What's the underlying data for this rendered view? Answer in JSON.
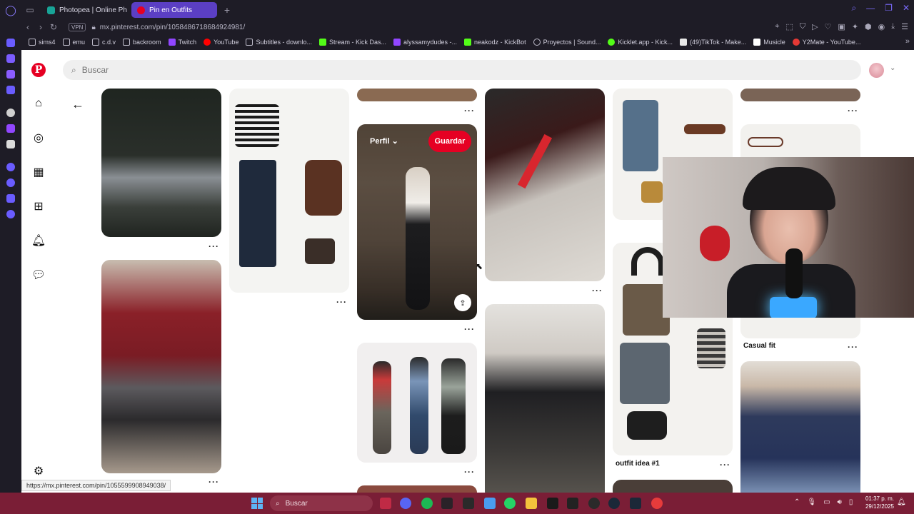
{
  "browser": {
    "tabs": [
      {
        "label": "Photopea | Online Photo E",
        "favicon_color": "#18a497"
      },
      {
        "label": "Pin en Outfits",
        "favicon_color": "#e60023",
        "active": true
      }
    ],
    "vpn_label": "VPN",
    "url": "mx.pinterest.com/pin/1058486718684924981/",
    "bookmarks": [
      {
        "label": "sims4",
        "icon": "folder-icon"
      },
      {
        "label": "emu",
        "icon": "folder-icon"
      },
      {
        "label": "c.d.v",
        "icon": "folder-icon"
      },
      {
        "label": "backroom",
        "icon": "folder-icon"
      },
      {
        "label": "Twitch",
        "icon": "twitch-icon",
        "color": "#9146ff"
      },
      {
        "label": "YouTube",
        "icon": "youtube-icon",
        "color": "#ff0000"
      },
      {
        "label": "Subtitles - downlo...",
        "icon": "subtitles-icon"
      },
      {
        "label": "Stream - Kick Das...",
        "icon": "kick-icon",
        "color": "#53fc18"
      },
      {
        "label": "alyssamydudes -...",
        "icon": "twitch-icon",
        "color": "#9146ff"
      },
      {
        "label": "neakodz - KickBot",
        "icon": "kickbot-icon",
        "color": "#53fc18"
      },
      {
        "label": "Proyectos | Sound...",
        "icon": "soundtrap-icon"
      },
      {
        "label": "Kicklet.app - Kick...",
        "icon": "kicklet-icon",
        "color": "#53fc18"
      },
      {
        "label": "(49)TikTok - Make...",
        "icon": "tiktok-icon"
      },
      {
        "label": "Musicle",
        "icon": "musicle-icon"
      },
      {
        "label": "Y2Mate - YouTube...",
        "icon": "y2mate-icon",
        "color": "#e53935"
      }
    ]
  },
  "pinterest": {
    "search_placeholder": "Buscar",
    "perfil_label": "Perfil",
    "save_button": "Guardar",
    "captions": {
      "casual_fit": "Casual fit",
      "outfit_idea": "outfit idea #1"
    },
    "more_dots": "···",
    "status_url": "https://mx.pinterest.com/pin/1055599908949038/"
  },
  "taskbar": {
    "search_label": "Buscar",
    "time": "01:37 p. m.",
    "date": "29/12/2025"
  },
  "colors": {
    "pinterest_red": "#e60023",
    "taskbar": "#7a1e36",
    "active_tab": "#5b3fc4"
  }
}
